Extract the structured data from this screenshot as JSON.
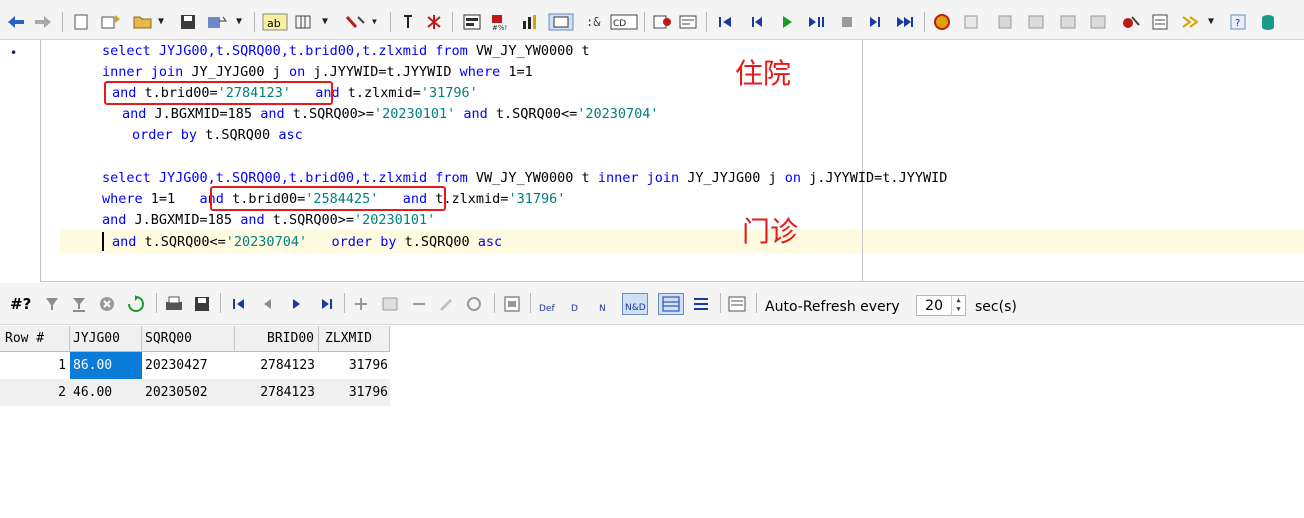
{
  "editor": {
    "lines": [
      [
        {
          "t": "select JYJG00,t.SQRQ00,t.brid00,t.zlxmid ",
          "k": "kw"
        },
        {
          "t": "from",
          "k": "kw"
        },
        {
          "t": " VW_JY_YW0000 t",
          "k": ""
        }
      ],
      [
        {
          "t": "inner join",
          "k": "kw"
        },
        {
          "t": " JY_JYJG00 j ",
          "k": ""
        },
        {
          "t": "on",
          "k": "kw"
        },
        {
          "t": " j.JYYWID=t.JYYWID ",
          "k": ""
        },
        {
          "t": "where",
          "k": "kw"
        },
        {
          "t": " 1=1",
          "k": ""
        }
      ],
      [
        {
          "t": "and",
          "k": "kw"
        },
        {
          "t": " t.brid00=",
          "k": ""
        },
        {
          "t": "'2784123'",
          "k": "st"
        },
        {
          "t": "   ",
          "k": ""
        },
        {
          "t": "and",
          "k": "kw"
        },
        {
          "t": " t.zlxmid=",
          "k": ""
        },
        {
          "t": "'31796'",
          "k": "st"
        }
      ],
      [
        {
          "t": "and",
          "k": "kw"
        },
        {
          "t": " J.BGXMID=185 ",
          "k": ""
        },
        {
          "t": "and",
          "k": "kw"
        },
        {
          "t": " t.SQRQ00>=",
          "k": ""
        },
        {
          "t": "'20230101'",
          "k": "st"
        },
        {
          "t": " ",
          "k": ""
        },
        {
          "t": "and",
          "k": "kw"
        },
        {
          "t": " t.SQRQ00<=",
          "k": ""
        },
        {
          "t": "'20230704'",
          "k": "st"
        }
      ],
      [
        {
          "t": "order by",
          "k": "kw"
        },
        {
          "t": " t.SQRQ00 ",
          "k": ""
        },
        {
          "t": "asc",
          "k": "kw"
        }
      ],
      [
        {
          "t": "select JYJG00,t.SQRQ00,t.brid00,t.zlxmid ",
          "k": "kw"
        },
        {
          "t": "from",
          "k": "kw"
        },
        {
          "t": " VW_JY_YW0000 t ",
          "k": ""
        },
        {
          "t": "inner join",
          "k": "kw"
        },
        {
          "t": " JY_JYJG00 j ",
          "k": ""
        },
        {
          "t": "on",
          "k": "kw"
        },
        {
          "t": " j.JYYWID=t.JYYWID",
          "k": ""
        }
      ],
      [
        {
          "t": "where",
          "k": "kw"
        },
        {
          "t": " 1=1   ",
          "k": ""
        },
        {
          "t": "and",
          "k": "kw"
        },
        {
          "t": " t.brid00=",
          "k": ""
        },
        {
          "t": "'2584425'",
          "k": "st"
        },
        {
          "t": "   ",
          "k": ""
        },
        {
          "t": "and",
          "k": "kw"
        },
        {
          "t": " t.zlxmid=",
          "k": ""
        },
        {
          "t": "'31796'",
          "k": "st"
        }
      ],
      [
        {
          "t": "and",
          "k": "kw"
        },
        {
          "t": " J.BGXMID=185 ",
          "k": ""
        },
        {
          "t": "and",
          "k": "kw"
        },
        {
          "t": " t.SQRQ00>=",
          "k": ""
        },
        {
          "t": "'20230101'",
          "k": "st"
        }
      ],
      [
        {
          "t": "and",
          "k": "kw"
        },
        {
          "t": " t.SQRQ00<=",
          "k": ""
        },
        {
          "t": "'20230704'",
          "k": "st"
        },
        {
          "t": "   ",
          "k": ""
        },
        {
          "t": "order by",
          "k": "kw"
        },
        {
          "t": " t.SQRQ00 ",
          "k": ""
        },
        {
          "t": "asc",
          "k": "kw"
        }
      ]
    ],
    "annotation_inpatient": "住院",
    "annotation_outpatient": "门诊",
    "gutter_marker": "•"
  },
  "grid_toolbar": {
    "query_button": "#?",
    "auto_refresh_label": "Auto-Refresh every",
    "refresh_interval": "20",
    "unit_label": "sec(s)"
  },
  "grid": {
    "columns": [
      "Row #",
      "JYJG00",
      "SQRQ00",
      "BRID00",
      "ZLXMID"
    ],
    "rows": [
      [
        "1",
        "86.00",
        "20230427",
        "2784123",
        "31796"
      ],
      [
        "2",
        "46.00",
        "20230502",
        "2784123",
        "31796"
      ]
    ]
  },
  "colors": {
    "keyword": "#0000ff",
    "string": "#008080",
    "annotation": "#e41b1b",
    "selection": "#0a7bd6"
  }
}
